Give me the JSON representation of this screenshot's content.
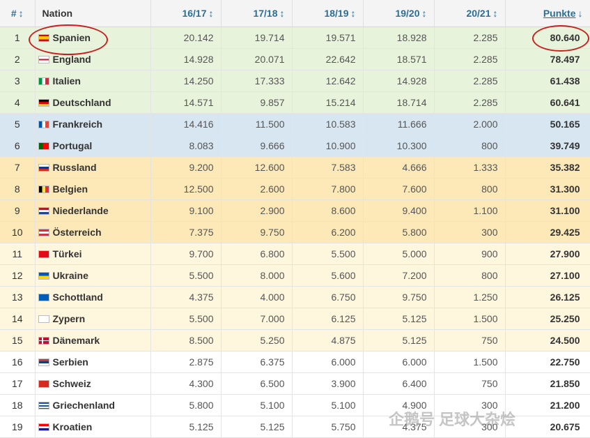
{
  "header": {
    "rank": "#",
    "nation": "Nation",
    "seasons": [
      "16/17",
      "17/18",
      "18/19",
      "19/20",
      "20/21"
    ],
    "points": "Punkte",
    "sort_icon": "↕",
    "sort_desc_icon": "↓"
  },
  "rows": [
    {
      "rank": "1",
      "nation": "Spanien",
      "values": [
        "20.142",
        "19.714",
        "19.571",
        "18.928",
        "2.285"
      ],
      "points": "80.640"
    },
    {
      "rank": "2",
      "nation": "England",
      "values": [
        "14.928",
        "20.071",
        "22.642",
        "18.571",
        "2.285"
      ],
      "points": "78.497"
    },
    {
      "rank": "3",
      "nation": "Italien",
      "values": [
        "14.250",
        "17.333",
        "12.642",
        "14.928",
        "2.285"
      ],
      "points": "61.438"
    },
    {
      "rank": "4",
      "nation": "Deutschland",
      "values": [
        "14.571",
        "9.857",
        "15.214",
        "18.714",
        "2.285"
      ],
      "points": "60.641"
    },
    {
      "rank": "5",
      "nation": "Frankreich",
      "values": [
        "14.416",
        "11.500",
        "10.583",
        "11.666",
        "2.000"
      ],
      "points": "50.165"
    },
    {
      "rank": "6",
      "nation": "Portugal",
      "values": [
        "8.083",
        "9.666",
        "10.900",
        "10.300",
        "800"
      ],
      "points": "39.749"
    },
    {
      "rank": "7",
      "nation": "Russland",
      "values": [
        "9.200",
        "12.600",
        "7.583",
        "4.666",
        "1.333"
      ],
      "points": "35.382"
    },
    {
      "rank": "8",
      "nation": "Belgien",
      "values": [
        "12.500",
        "2.600",
        "7.800",
        "7.600",
        "800"
      ],
      "points": "31.300"
    },
    {
      "rank": "9",
      "nation": "Niederlande",
      "values": [
        "9.100",
        "2.900",
        "8.600",
        "9.400",
        "1.100"
      ],
      "points": "31.100"
    },
    {
      "rank": "10",
      "nation": "Österreich",
      "values": [
        "7.375",
        "9.750",
        "6.200",
        "5.800",
        "300"
      ],
      "points": "29.425"
    },
    {
      "rank": "11",
      "nation": "Türkei",
      "values": [
        "9.700",
        "6.800",
        "5.500",
        "5.000",
        "900"
      ],
      "points": "27.900"
    },
    {
      "rank": "12",
      "nation": "Ukraine",
      "values": [
        "5.500",
        "8.000",
        "5.600",
        "7.200",
        "800"
      ],
      "points": "27.100"
    },
    {
      "rank": "13",
      "nation": "Schottland",
      "values": [
        "4.375",
        "4.000",
        "6.750",
        "9.750",
        "1.250"
      ],
      "points": "26.125"
    },
    {
      "rank": "14",
      "nation": "Zypern",
      "values": [
        "5.500",
        "7.000",
        "6.125",
        "5.125",
        "1.500"
      ],
      "points": "25.250"
    },
    {
      "rank": "15",
      "nation": "Dänemark",
      "values": [
        "8.500",
        "5.250",
        "4.875",
        "5.125",
        "750"
      ],
      "points": "24.500"
    },
    {
      "rank": "16",
      "nation": "Serbien",
      "values": [
        "2.875",
        "6.375",
        "6.000",
        "6.000",
        "1.500"
      ],
      "points": "22.750"
    },
    {
      "rank": "17",
      "nation": "Schweiz",
      "values": [
        "4.300",
        "6.500",
        "3.900",
        "6.400",
        "750"
      ],
      "points": "21.850"
    },
    {
      "rank": "18",
      "nation": "Griechenland",
      "values": [
        "5.800",
        "5.100",
        "5.100",
        "4.900",
        "300"
      ],
      "points": "21.200"
    },
    {
      "rank": "19",
      "nation": "Kroatien",
      "values": [
        "5.125",
        "5.125",
        "5.750",
        "4.375",
        "300"
      ],
      "points": "20.675"
    }
  ],
  "row_colors": {
    "green": "#e8f3dc",
    "blue": "#d7e6f0",
    "yellow": "#fde9b8",
    "lightyellow": "#fef6dd",
    "white": "#ffffff"
  },
  "flags": {
    "Spanien": "flag-spain-icon",
    "England": "flag-england-icon",
    "Italien": "flag-italy-icon",
    "Deutschland": "flag-germany-icon",
    "Frankreich": "flag-france-icon",
    "Portugal": "flag-portugal-icon",
    "Russland": "flag-russia-icon",
    "Belgien": "flag-belgium-icon",
    "Niederlande": "flag-netherlands-icon",
    "Österreich": "flag-austria-icon",
    "Türkei": "flag-turkey-icon",
    "Ukraine": "flag-ukraine-icon",
    "Schottland": "flag-scotland-icon",
    "Zypern": "flag-cyprus-icon",
    "Dänemark": "flag-denmark-icon",
    "Serbien": "flag-serbia-icon",
    "Schweiz": "flag-switzerland-icon",
    "Griechenland": "flag-greece-icon",
    "Kroatien": "flag-croatia-icon"
  },
  "highlight_color": "#c9201f",
  "watermark": "企鹅号 足球大杂烩"
}
